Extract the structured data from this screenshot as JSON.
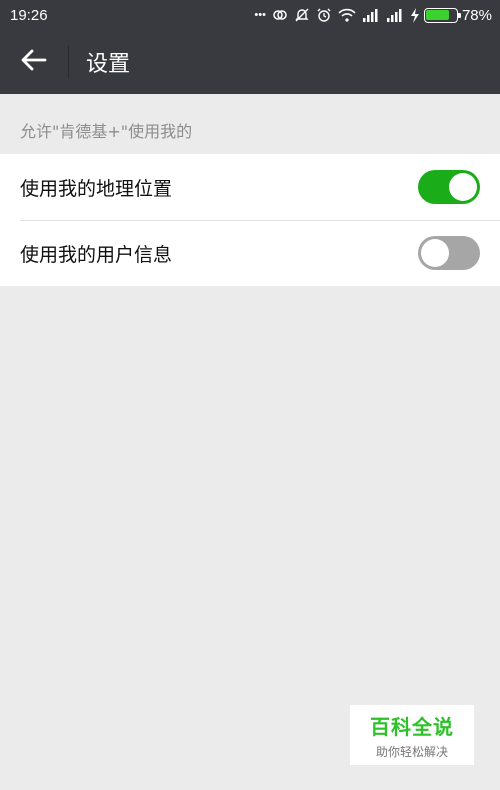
{
  "status_bar": {
    "time": "19:26",
    "more_dots": "•••",
    "battery_percent": "78%",
    "battery_level": 0.78,
    "icons": [
      "link-icon",
      "bell-off-icon",
      "alarm-icon",
      "wifi-icon",
      "signal-icon",
      "signal-icon",
      "charging-icon",
      "battery-icon"
    ]
  },
  "header": {
    "back_icon": "arrow-left-icon",
    "title": "设置"
  },
  "section": {
    "label": "允许\"肯德基+\"使用我的"
  },
  "settings": [
    {
      "label": "使用我的地理位置",
      "enabled": true
    },
    {
      "label": "使用我的用户信息",
      "enabled": false
    }
  ],
  "colors": {
    "header_bg": "#393a3f",
    "toggle_on": "#1aad19",
    "toggle_off": "#a6a6a6",
    "page_bg": "#ebebeb"
  },
  "watermark": {
    "logo": "百科全说",
    "subtitle": "助你轻松解决"
  }
}
